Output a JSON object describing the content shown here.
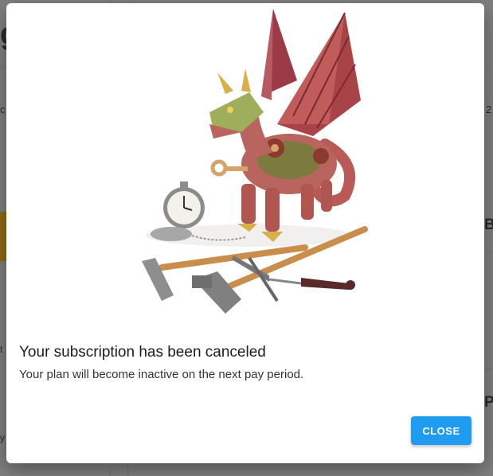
{
  "background": {
    "partial_texts": [
      "g",
      "c",
      "t",
      "y",
      "B",
      "P",
      "2"
    ]
  },
  "dialog": {
    "illustration_icon": "steampunk-dragon-with-tools-illustration",
    "title": "Your subscription has been canceled",
    "message": "Your plan will become inactive on the next pay period.",
    "close_label": "CLOSE"
  },
  "colors": {
    "accent": "#1f9bf0",
    "backdrop": "#7f7f7f",
    "dialog_bg": "#ffffff",
    "title": "#1d1d1d",
    "body_text": "#333333"
  }
}
